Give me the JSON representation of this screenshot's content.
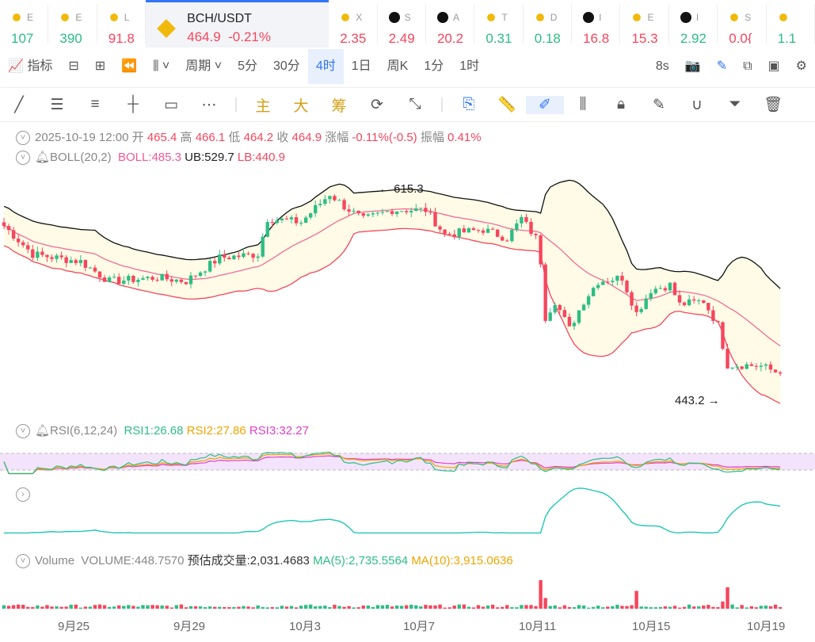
{
  "ticker": [
    {
      "sym": "E",
      "price": "107",
      "dir": "g",
      "icon": "binance"
    },
    {
      "sym": "E",
      "price": "390",
      "dir": "g",
      "icon": "binance"
    },
    {
      "sym": "L",
      "price": "91.8",
      "dir": "r",
      "icon": "binance"
    },
    {
      "active": true,
      "sym": "BCH/USDT",
      "price": "464.9",
      "change": "-0.21%",
      "dir": "r",
      "icon": "binance"
    },
    {
      "sym": "X",
      "price": "2.35",
      "dir": "r",
      "icon": "binance"
    },
    {
      "sym": "S",
      "price": "2.49",
      "dir": "r",
      "icon": "okx"
    },
    {
      "sym": "A",
      "price": "20.2",
      "dir": "r",
      "icon": "okx"
    },
    {
      "sym": "T",
      "price": "0.31",
      "dir": "g",
      "icon": "binance"
    },
    {
      "sym": "D",
      "price": "0.18",
      "dir": "g",
      "icon": "binance"
    },
    {
      "sym": "I",
      "price": "16.8",
      "dir": "r",
      "icon": "okx"
    },
    {
      "sym": "E",
      "price": "15.3",
      "dir": "r",
      "icon": "binance"
    },
    {
      "sym": "I",
      "price": "2.92",
      "dir": "g",
      "icon": "okx"
    },
    {
      "sym": "S",
      "price": "0.0{",
      "dir": "r",
      "icon": "binance"
    },
    {
      "sym": "",
      "price": "1.1",
      "dir": "g",
      "icon": "binance"
    }
  ],
  "toolbar": {
    "indicator": "指标",
    "period": "周期",
    "intervals": [
      "5分",
      "30分",
      "4时",
      "1日",
      "周K",
      "1分",
      "1时"
    ],
    "selected": "4时",
    "refresh": "8s"
  },
  "drawing": {
    "main": "主",
    "big": "大",
    "chips": "筹"
  },
  "ohlc": {
    "time": "2025-10-19 12:00",
    "open_l": "开",
    "open": "465.4",
    "high_l": "高",
    "high": "466.1",
    "low_l": "低",
    "low": "464.2",
    "close_l": "收",
    "close": "464.9",
    "chg_l": "涨幅",
    "chg": "-0.11%(-0.5)",
    "amp_l": "振幅",
    "amp": "0.41%"
  },
  "boll": {
    "name": "BOLL(20,2)",
    "mid": "BOLL:485.3",
    "ub": "UB:529.7",
    "lb": "LB:440.9"
  },
  "rsi": {
    "name": "RSI(6,12,24)",
    "r1": "RSI1:26.68",
    "r2": "RSI2:27.86",
    "r3": "RSI3:32.27"
  },
  "volume": {
    "name": "Volume",
    "vol": "VOLUME:448.7570",
    "est": "预估成交量:2,031.4683",
    "ma5": "MA(5):2,735.5564",
    "ma10": "MA(10):3,915.0636"
  },
  "colors": {
    "up": "#2ebd85",
    "down": "#f6465d",
    "accent": "#3375f6"
  },
  "chart_data": {
    "type": "candlestick",
    "symbol": "BCH/USDT",
    "interval": "4h",
    "x_ticks": [
      "9月25",
      "9月29",
      "10月3",
      "10月7",
      "10月11",
      "10月15",
      "10月19"
    ],
    "max_label": "← 615.3",
    "min_label": "443.2 →",
    "close_path": [
      [
        0,
        585
      ],
      [
        6,
        562
      ],
      [
        16,
        556
      ],
      [
        22,
        540
      ],
      [
        32,
        543
      ],
      [
        38,
        540
      ],
      [
        45,
        559
      ],
      [
        53,
        562
      ],
      [
        55,
        591
      ],
      [
        62,
        588
      ],
      [
        68,
        611
      ],
      [
        71,
        601
      ],
      [
        75,
        590
      ],
      [
        81,
        598
      ],
      [
        88,
        598
      ],
      [
        92,
        578
      ],
      [
        100,
        582
      ],
      [
        105,
        575
      ],
      [
        108,
        591
      ],
      [
        111,
        575
      ],
      [
        112,
        556
      ],
      [
        113,
        511
      ],
      [
        115,
        524
      ],
      [
        118,
        501
      ],
      [
        121,
        524
      ],
      [
        124,
        540
      ],
      [
        129,
        543
      ],
      [
        132,
        514
      ],
      [
        135,
        533
      ],
      [
        139,
        537
      ],
      [
        141,
        521
      ],
      [
        146,
        524
      ],
      [
        149,
        504
      ],
      [
        151,
        472
      ],
      [
        154,
        472
      ],
      [
        158,
        471
      ],
      [
        162,
        464.9
      ]
    ],
    "volume_spikes": [
      [
        112,
        8
      ],
      [
        113,
        3
      ],
      [
        132,
        5
      ],
      [
        151,
        6
      ],
      [
        150,
        2
      ]
    ]
  }
}
